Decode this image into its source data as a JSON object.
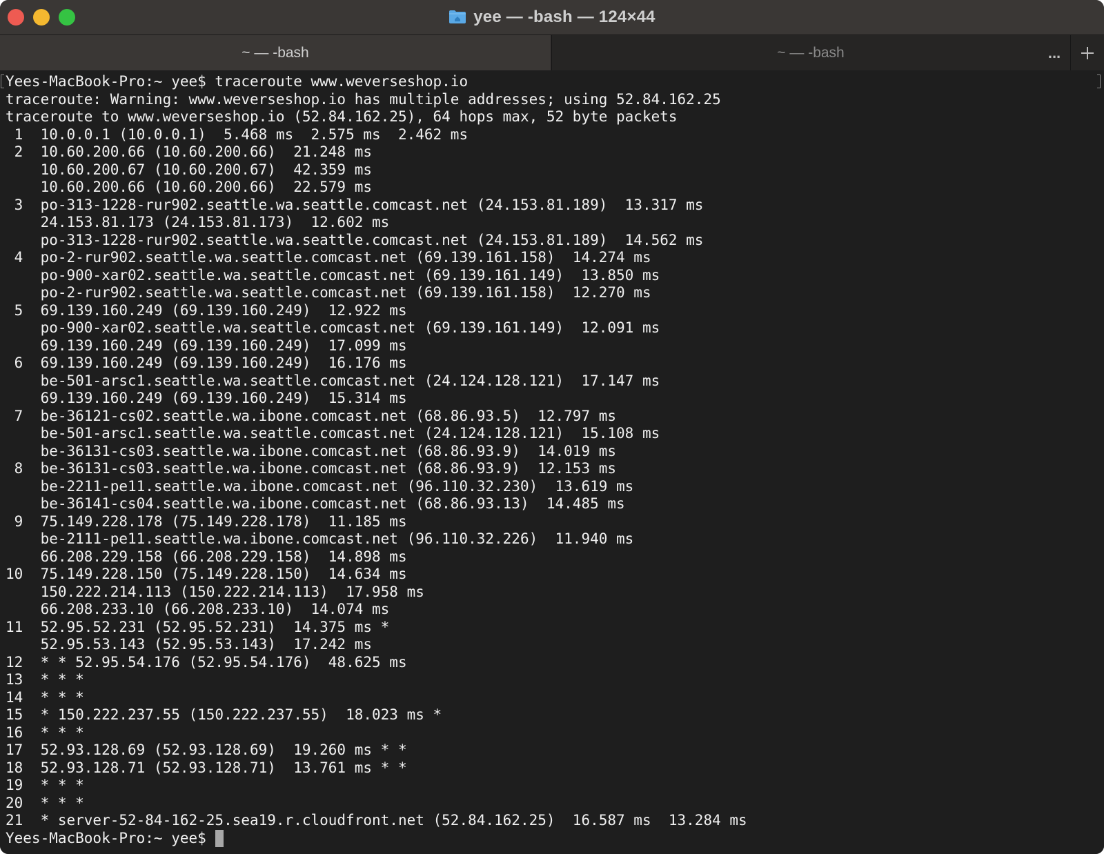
{
  "window": {
    "title": "yee — -bash — 124×44",
    "title_icon": "folder-home-icon",
    "controls": [
      "close-button",
      "minimize-button",
      "zoom-button"
    ]
  },
  "tabs": [
    {
      "label": "~ — -bash",
      "active": true
    },
    {
      "label": "~ — -bash",
      "active": false
    }
  ],
  "tab_actions": {
    "overflow_label": "...",
    "add_icon": "plus-icon"
  },
  "terminal": {
    "lines": [
      "Yees-MacBook-Pro:~ yee$ traceroute www.weverseshop.io",
      "traceroute: Warning: www.weverseshop.io has multiple addresses; using 52.84.162.25",
      "traceroute to www.weverseshop.io (52.84.162.25), 64 hops max, 52 byte packets",
      " 1  10.0.0.1 (10.0.0.1)  5.468 ms  2.575 ms  2.462 ms",
      " 2  10.60.200.66 (10.60.200.66)  21.248 ms",
      "    10.60.200.67 (10.60.200.67)  42.359 ms",
      "    10.60.200.66 (10.60.200.66)  22.579 ms",
      " 3  po-313-1228-rur902.seattle.wa.seattle.comcast.net (24.153.81.189)  13.317 ms",
      "    24.153.81.173 (24.153.81.173)  12.602 ms",
      "    po-313-1228-rur902.seattle.wa.seattle.comcast.net (24.153.81.189)  14.562 ms",
      " 4  po-2-rur902.seattle.wa.seattle.comcast.net (69.139.161.158)  14.274 ms",
      "    po-900-xar02.seattle.wa.seattle.comcast.net (69.139.161.149)  13.850 ms",
      "    po-2-rur902.seattle.wa.seattle.comcast.net (69.139.161.158)  12.270 ms",
      " 5  69.139.160.249 (69.139.160.249)  12.922 ms",
      "    po-900-xar02.seattle.wa.seattle.comcast.net (69.139.161.149)  12.091 ms",
      "    69.139.160.249 (69.139.160.249)  17.099 ms",
      " 6  69.139.160.249 (69.139.160.249)  16.176 ms",
      "    be-501-arsc1.seattle.wa.seattle.comcast.net (24.124.128.121)  17.147 ms",
      "    69.139.160.249 (69.139.160.249)  15.314 ms",
      " 7  be-36121-cs02.seattle.wa.ibone.comcast.net (68.86.93.5)  12.797 ms",
      "    be-501-arsc1.seattle.wa.seattle.comcast.net (24.124.128.121)  15.108 ms",
      "    be-36131-cs03.seattle.wa.ibone.comcast.net (68.86.93.9)  14.019 ms",
      " 8  be-36131-cs03.seattle.wa.ibone.comcast.net (68.86.93.9)  12.153 ms",
      "    be-2211-pe11.seattle.wa.ibone.comcast.net (96.110.32.230)  13.619 ms",
      "    be-36141-cs04.seattle.wa.ibone.comcast.net (68.86.93.13)  14.485 ms",
      " 9  75.149.228.178 (75.149.228.178)  11.185 ms",
      "    be-2111-pe11.seattle.wa.ibone.comcast.net (96.110.32.226)  11.940 ms",
      "    66.208.229.158 (66.208.229.158)  14.898 ms",
      "10  75.149.228.150 (75.149.228.150)  14.634 ms",
      "    150.222.214.113 (150.222.214.113)  17.958 ms",
      "    66.208.233.10 (66.208.233.10)  14.074 ms",
      "11  52.95.52.231 (52.95.52.231)  14.375 ms *",
      "    52.95.53.143 (52.95.53.143)  17.242 ms",
      "12  * * 52.95.54.176 (52.95.54.176)  48.625 ms",
      "13  * * *",
      "14  * * *",
      "15  * 150.222.237.55 (150.222.237.55)  18.023 ms *",
      "16  * * *",
      "17  52.93.128.69 (52.93.128.69)  19.260 ms * *",
      "18  52.93.128.71 (52.93.128.71)  13.761 ms * *",
      "19  * * *",
      "20  * * *",
      "21  * server-52-84-162-25.sea19.r.cloudfront.net (52.84.162.25)  16.587 ms  13.284 ms"
    ],
    "prompt": "Yees-MacBook-Pro:~ yee$"
  },
  "colors": {
    "terminal_bg": "#1e1e1e",
    "terminal_fg": "#f0f0f0",
    "titlebar_bg": "#3a3735",
    "close": "#ee5b52",
    "minimize": "#f4b830",
    "zoom": "#35c343",
    "folder_icon": "#5aa9e6"
  }
}
